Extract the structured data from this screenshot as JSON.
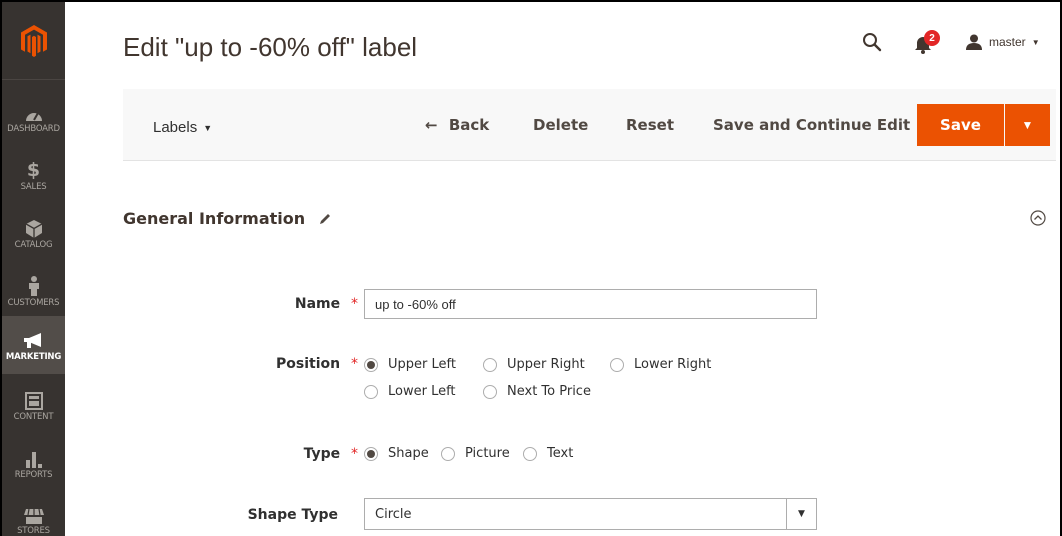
{
  "sidebar": {
    "items": [
      {
        "label": "DASHBOARD",
        "icon": "dashboard-icon"
      },
      {
        "label": "SALES",
        "icon": "dollar-icon"
      },
      {
        "label": "CATALOG",
        "icon": "box-icon"
      },
      {
        "label": "CUSTOMERS",
        "icon": "person-icon"
      },
      {
        "label": "MARKETING",
        "icon": "megaphone-icon",
        "active": true
      },
      {
        "label": "CONTENT",
        "icon": "layout-icon"
      },
      {
        "label": "REPORTS",
        "icon": "bar-chart-icon"
      },
      {
        "label": "STORES",
        "icon": "store-icon"
      }
    ]
  },
  "header": {
    "title": "Edit \"up to -60% off\" label",
    "notifications_count": "2",
    "user_name": "master"
  },
  "toolbar": {
    "labels_switch": "Labels",
    "back": "Back",
    "delete": "Delete",
    "reset": "Reset",
    "save_continue": "Save and Continue Edit",
    "save": "Save"
  },
  "section": {
    "title": "General Information"
  },
  "form": {
    "name_label": "Name",
    "name_value": "up to -60% off",
    "position_label": "Position",
    "position_options": [
      "Upper Left",
      "Upper Right",
      "Lower Right",
      "Lower Left",
      "Next To Price"
    ],
    "position_selected": "Upper Left",
    "type_label": "Type",
    "type_options": [
      "Shape",
      "Picture",
      "Text"
    ],
    "type_selected": "Shape",
    "shape_type_label": "Shape Type",
    "shape_type_value": "Circle",
    "required_mark": "*"
  },
  "colors": {
    "sidebar_bg": "#373330",
    "sidebar_active": "#524d49",
    "accent": "#eb5202",
    "logo": "#eb5202",
    "badge": "#e22626"
  }
}
